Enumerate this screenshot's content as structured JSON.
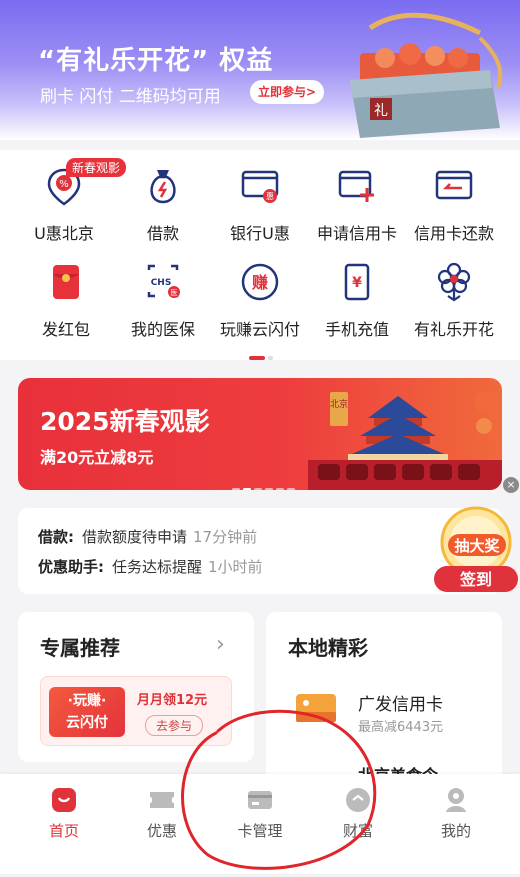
{
  "hero": {
    "title": "“有礼乐开花” 权益",
    "subtitle": "刷卡  闪付  二维码均可用",
    "cta": "立即参与>",
    "gift_box_label": "礼"
  },
  "services": [
    {
      "label": "U惠北京",
      "icon": "u-hui-beijing-icon",
      "badge": "新春观影"
    },
    {
      "label": "借款",
      "icon": "loan-bag-icon"
    },
    {
      "label": "银行U惠",
      "icon": "bank-card-hui-icon"
    },
    {
      "label": "申请信用卡",
      "icon": "apply-card-icon"
    },
    {
      "label": "信用卡还款",
      "icon": "card-repay-icon"
    },
    {
      "label": "发红包",
      "icon": "red-packet-icon"
    },
    {
      "label": "我的医保",
      "icon": "medical-insurance-icon",
      "icon_text": "CHS"
    },
    {
      "label": "玩赚云闪付",
      "icon": "earn-icon",
      "icon_text": "赚"
    },
    {
      "label": "手机充值",
      "icon": "phone-recharge-icon",
      "icon_text": "¥"
    },
    {
      "label": "有礼乐开花",
      "icon": "flower-icon"
    }
  ],
  "banner": {
    "title": "2025新春观影",
    "subtitle": "满20元立减8元",
    "sign_text": "北京",
    "close": "×"
  },
  "notices": [
    {
      "key": "借款:",
      "value": "借款额度待申请",
      "time": "17分钟前"
    },
    {
      "key": "优惠助手:",
      "value": "任务达标提醒",
      "time": "1小时前"
    }
  ],
  "lottery": {
    "top": "抽大奖",
    "bottom": "签到"
  },
  "recommend": {
    "title": "专属推荐",
    "chevron": "›",
    "promo_tag_line1": "·玩赚·",
    "promo_tag_line2": "云闪付",
    "promo_text": "月月领12元",
    "promo_button": "去参与"
  },
  "local": {
    "title": "本地精彩",
    "item_name": "广发信用卡",
    "item_desc": "最高减6443元",
    "next_item": "北京美食令"
  },
  "tabbar": [
    {
      "label": "首页",
      "icon": "home-icon",
      "active": true
    },
    {
      "label": "优惠",
      "icon": "coupon-icon",
      "active": false
    },
    {
      "label": "卡管理",
      "icon": "card-manage-icon",
      "active": false
    },
    {
      "label": "财富",
      "icon": "wealth-icon",
      "active": false
    },
    {
      "label": "我的",
      "icon": "profile-icon",
      "active": false
    }
  ],
  "colors": {
    "brand_red": "#e0323a",
    "hero_purple": "#7b6cf0",
    "annotation_red": "#e0252b"
  }
}
